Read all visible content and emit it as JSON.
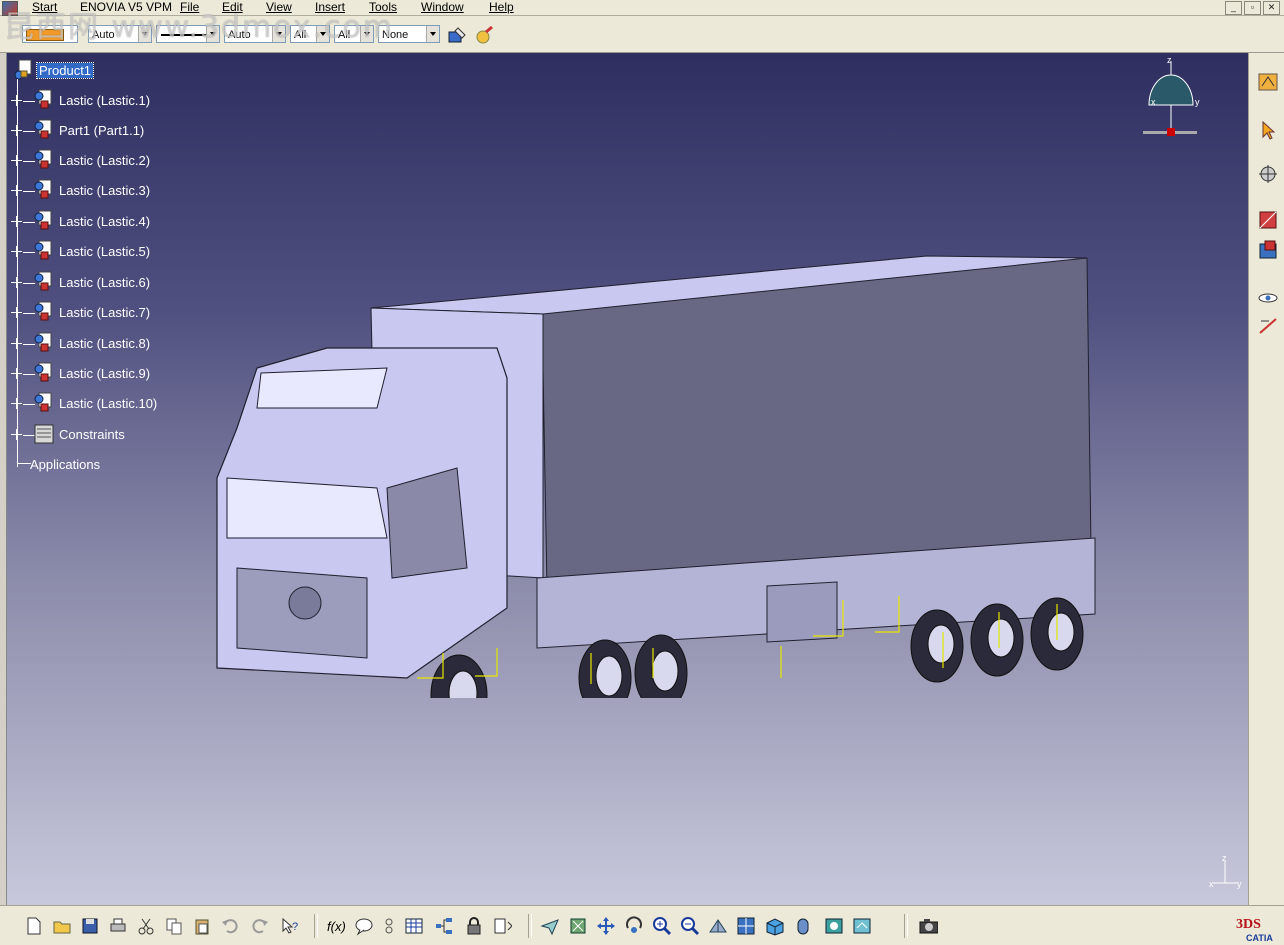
{
  "menubar": {
    "items": [
      "Start",
      "ENOVIA V5 VPM",
      "File",
      "Edit",
      "View",
      "Insert",
      "Tools",
      "Window",
      "Help"
    ]
  },
  "watermark": "昆西网 www.3dmox.com",
  "toolbar": {
    "combo_linetype": "Auto",
    "combo_thickness": "Auto",
    "combo_layer": "All",
    "combo_rendering": "All",
    "combo_none": "None"
  },
  "tree": {
    "root": "Product1",
    "children": [
      "Lastic (Lastic.1)",
      "Part1 (Part1.1)",
      "Lastic (Lastic.2)",
      "Lastic (Lastic.3)",
      "Lastic (Lastic.4)",
      "Lastic (Lastic.5)",
      "Lastic (Lastic.6)",
      "Lastic (Lastic.7)",
      "Lastic (Lastic.8)",
      "Lastic (Lastic.9)",
      "Lastic (Lastic.10)",
      "Constraints"
    ],
    "applications": "Applications"
  },
  "compass": {
    "x": "x",
    "y": "y",
    "z": "z"
  },
  "mini_axes": {
    "x": "x",
    "y": "y",
    "z": "z"
  },
  "catia_logo": "CATIA",
  "colors": {
    "bg_top": "#2e2e60",
    "bg_bottom": "#c8c8dc",
    "truck": "#c8c8f0",
    "constraint": "#e6e600",
    "highlight": "#3169c6"
  }
}
